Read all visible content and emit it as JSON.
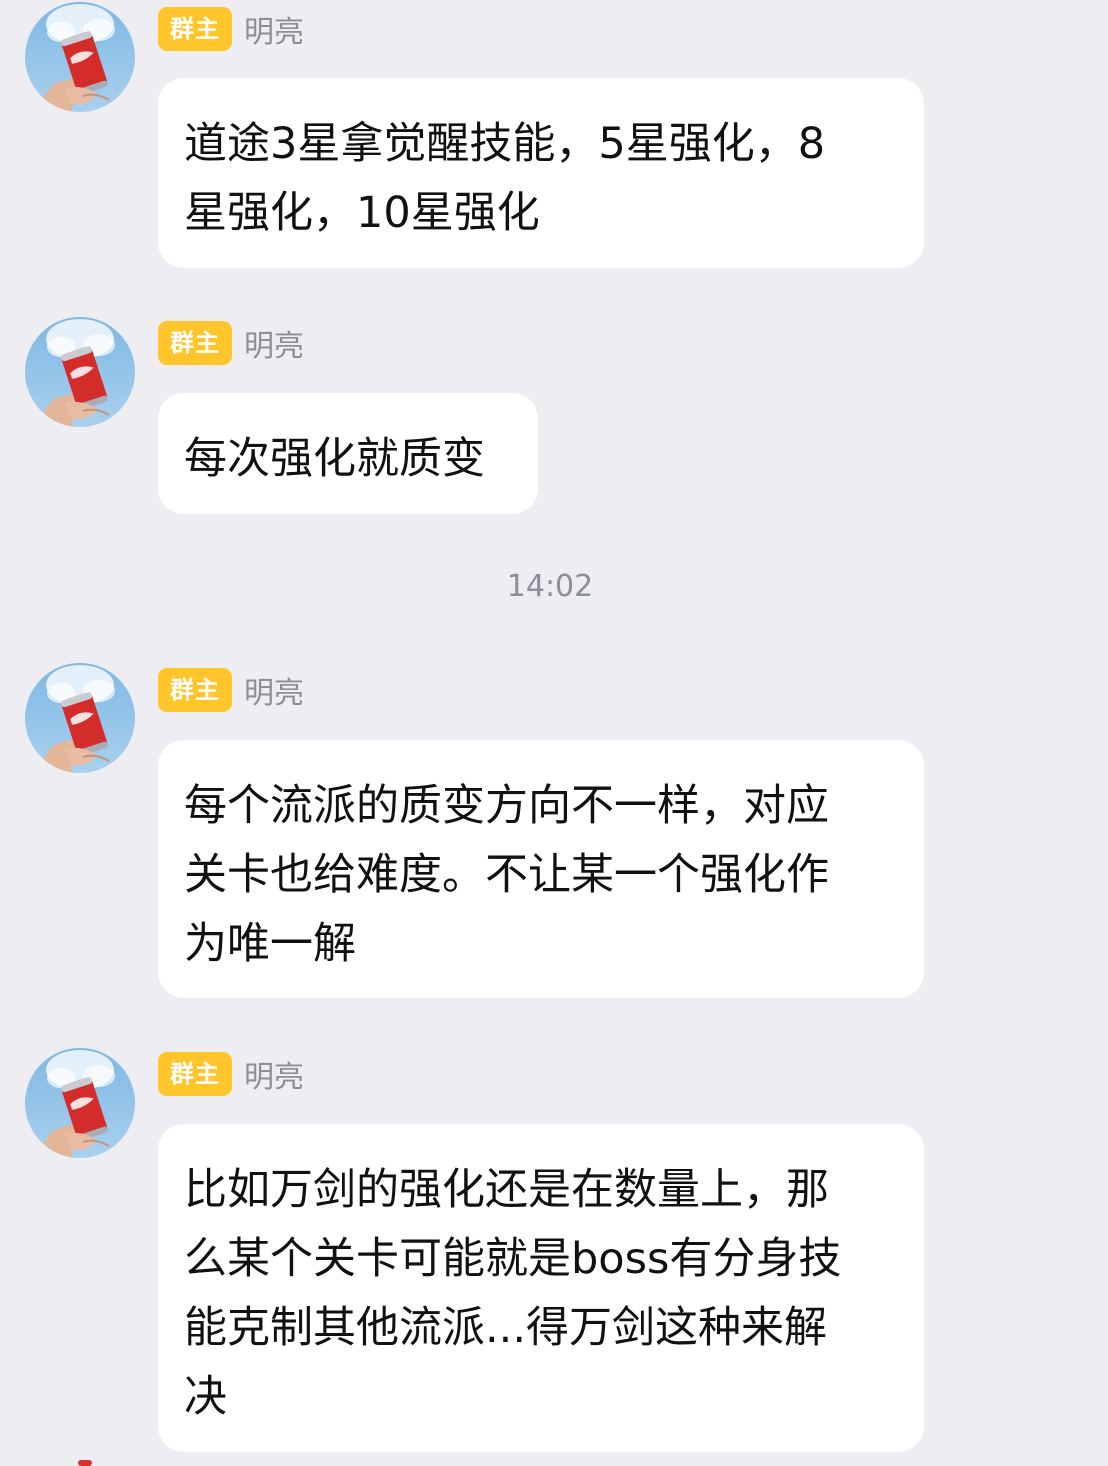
{
  "chat": {
    "messages": [
      {
        "badge": "群主",
        "sender": "明亮",
        "text": "道途3星拿觉醒技能，5星强化，8\n星强化，10星强化"
      },
      {
        "badge": "群主",
        "sender": "明亮",
        "text": "每次强化就质变"
      },
      {
        "badge": "群主",
        "sender": "明亮",
        "text": "每个流派的质变方向不一样，对应\n关卡也给难度。不让某一个强化作\n为唯一解"
      },
      {
        "badge": "群主",
        "sender": "明亮",
        "text": "比如万剑的强化还是在数量上，那\n么某个关卡可能就是boss有分身技\n能克制其他流派...得万剑这种来解\n决"
      }
    ],
    "timestamp": "14:02"
  },
  "colors": {
    "background": "#eeeef2",
    "bubble": "#ffffff",
    "badge": "#ffc52b",
    "name": "#8e8e93",
    "timestamp": "#8b8f97"
  },
  "icons": {
    "avatar": "avatar-coca-cola-can-in-hand"
  }
}
